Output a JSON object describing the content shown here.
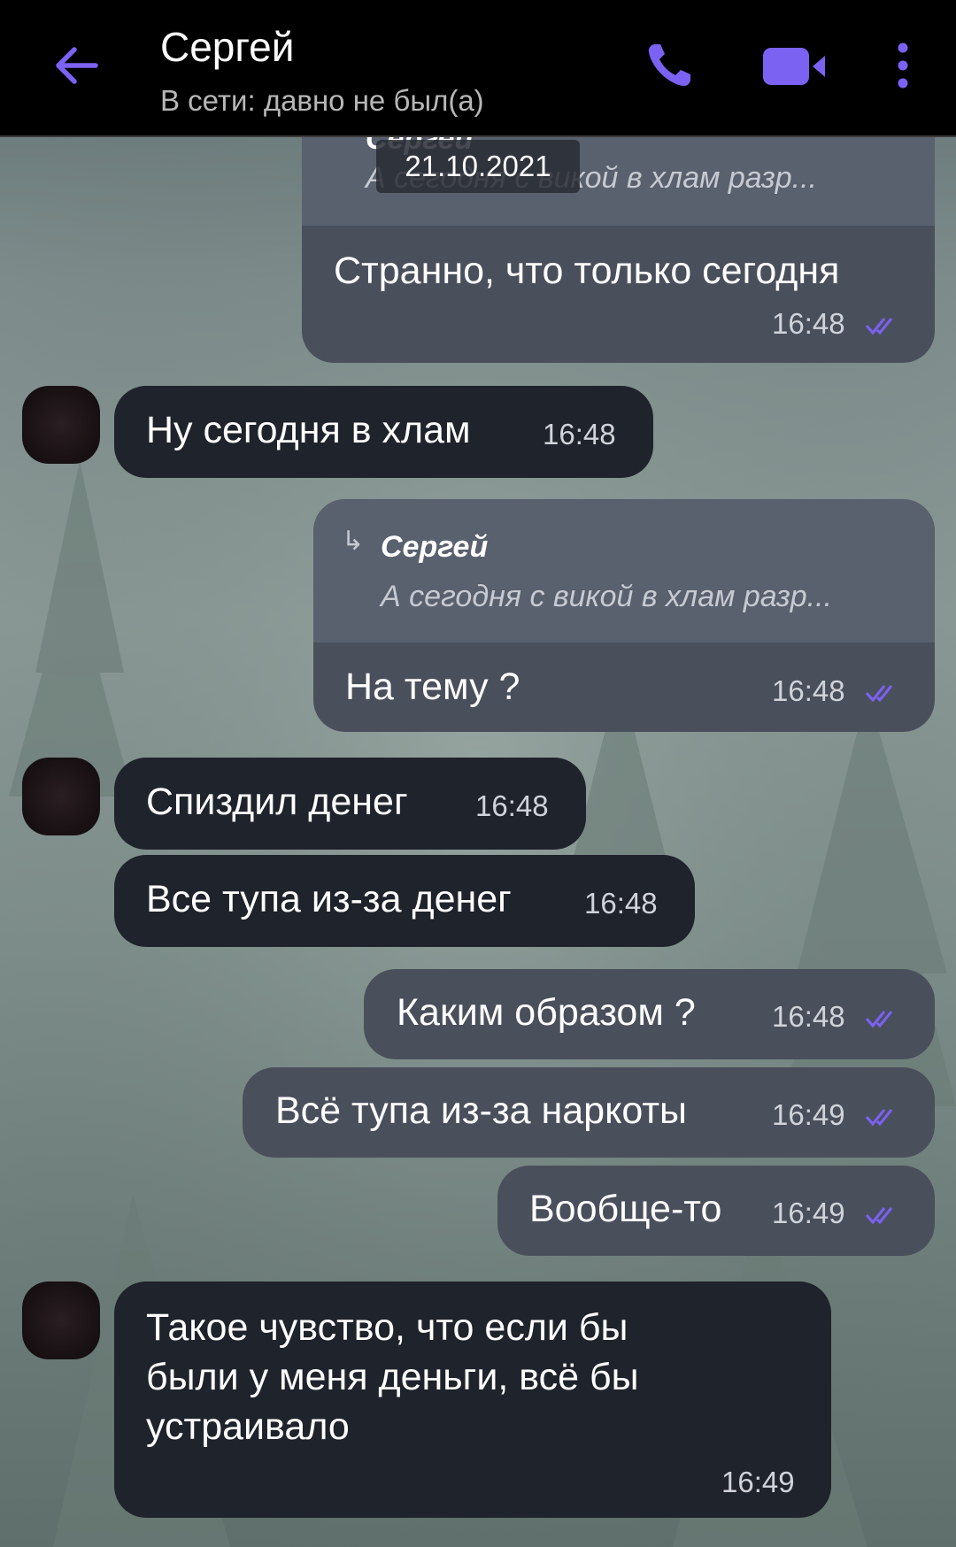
{
  "header": {
    "contact_name": "Сергей",
    "status": "В сети: давно не был(а)",
    "accent": "#7b62f2"
  },
  "date_divider": "21.10.2021",
  "messages": [
    {
      "dir": "out",
      "quote": {
        "name": "Сергей",
        "text": "А сегодня с викой в хлам разр..."
      },
      "text": "Странно, что только сегодня",
      "time": "16:48",
      "read": true
    },
    {
      "dir": "in",
      "text": "Ну сегодня в хлам",
      "time": "16:48"
    },
    {
      "dir": "out",
      "quote": {
        "name": "Сергей",
        "text": "А сегодня с викой в хлам разр..."
      },
      "text": "На тему ?",
      "time": "16:48",
      "read": true
    },
    {
      "dir": "in",
      "text": "Спиздил денег",
      "time": "16:48"
    },
    {
      "dir": "in",
      "text": "Все тупа из-за денег",
      "time": "16:48"
    },
    {
      "dir": "out",
      "text": "Каким образом ?",
      "time": "16:48",
      "read": true
    },
    {
      "dir": "out",
      "text": "Всё тупа из-за наркоты",
      "time": "16:49",
      "read": true
    },
    {
      "dir": "out",
      "text": "Вообще-то",
      "time": "16:49",
      "read": true
    },
    {
      "dir": "in",
      "lines": [
        "Такое чувство, что если бы",
        "были у меня деньги, всё бы",
        "устраивало"
      ],
      "time": "16:49"
    }
  ]
}
